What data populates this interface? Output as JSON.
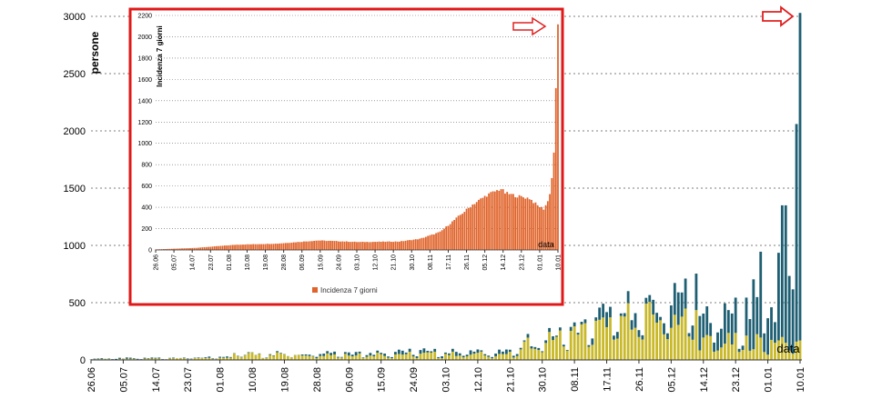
{
  "chart_data": [
    {
      "type": "bar",
      "title": "",
      "xlabel": "data",
      "ylabel": "persone",
      "ylim": [
        0,
        3000
      ],
      "yticks": [
        0,
        500,
        1000,
        1500,
        2000,
        2500,
        3000
      ],
      "grid": "horizontal dotted",
      "stacked": true,
      "date_tick_labels": [
        "26.06",
        "05.07",
        "14.07",
        "23.07",
        "01.08",
        "10.08",
        "19.08",
        "28.08",
        "06.09",
        "15.09",
        "24.09",
        "03.10",
        "12.10",
        "21.10",
        "30.10",
        "08.11",
        "17.11",
        "26.11",
        "05.12",
        "14.12",
        "23.12",
        "01.01",
        "10.01"
      ],
      "colors": {
        "base": "#c8b82a",
        "top": "#1f5f73"
      },
      "highlight_arrow": "right-arrow at last bar (10.01)"
    },
    {
      "type": "bar",
      "title": "",
      "xlabel": "data",
      "ylabel": "Incidenza 7 giorni",
      "legend": "bottom",
      "ylim": [
        0,
        2200
      ],
      "yticks": [
        0,
        200,
        400,
        600,
        800,
        1000,
        1200,
        1400,
        1600,
        1800,
        2000,
        2200
      ],
      "series": [
        {
          "name": "Incidenza 7 giorni",
          "color": "#e0632a"
        }
      ],
      "date_tick_labels": [
        "26.06",
        "05.07",
        "14.07",
        "23.07",
        "01.08",
        "10.08",
        "19.08",
        "28.08",
        "06.09",
        "15.09",
        "24.09",
        "03.10",
        "12.10",
        "21.10",
        "30.10",
        "08.11",
        "17.11",
        "26.11",
        "05.12",
        "14.12",
        "23.12",
        "01.01",
        "10.01"
      ],
      "highlight_arrow": "right-arrow at last bar (10.01)"
    }
  ],
  "legend_label": "Incidenza 7 giorni"
}
